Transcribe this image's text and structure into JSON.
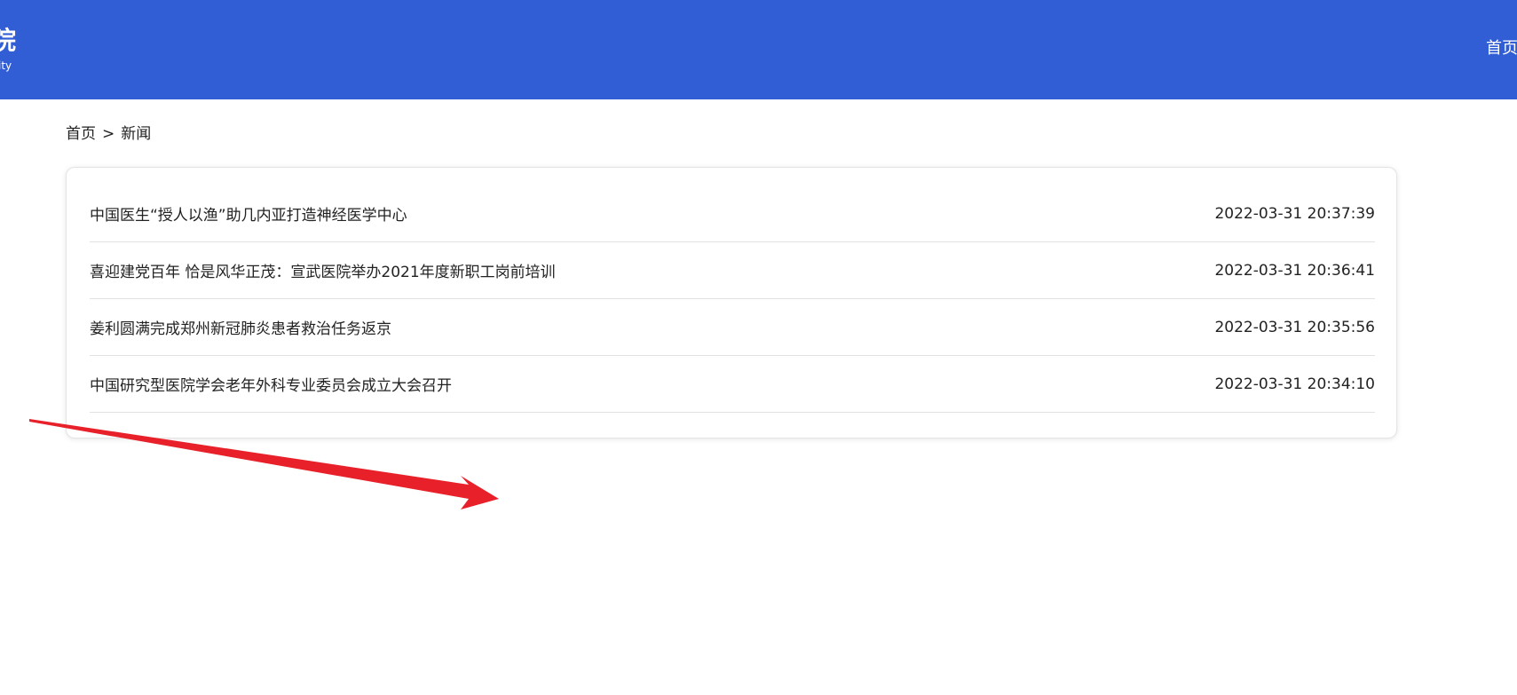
{
  "header": {
    "logo_title": "院",
    "logo_subtitle": "ity",
    "nav_home": "首页",
    "bg_color": "#325ed5"
  },
  "breadcrumb": {
    "home": "首页",
    "separator": ">",
    "current": "新闻"
  },
  "news": {
    "items": [
      {
        "title": "中国医生“授人以渔”助几内亚打造神经医学中心",
        "date": "2022-03-31 20:37:39"
      },
      {
        "title": "喜迎建党百年 恰是风华正茂：宣武医院举办2021年度新职工岗前培训",
        "date": "2022-03-31 20:36:41"
      },
      {
        "title": "姜利圆满完成郑州新冠肺炎患者救治任务返京",
        "date": "2022-03-31 20:35:56"
      },
      {
        "title": "中国研究型医院学会老年外科专业委员会成立大会召开",
        "date": "2022-03-31 20:34:10"
      }
    ]
  },
  "annotation": {
    "icon": "red-arrow-icon",
    "color": "#e8202a"
  }
}
